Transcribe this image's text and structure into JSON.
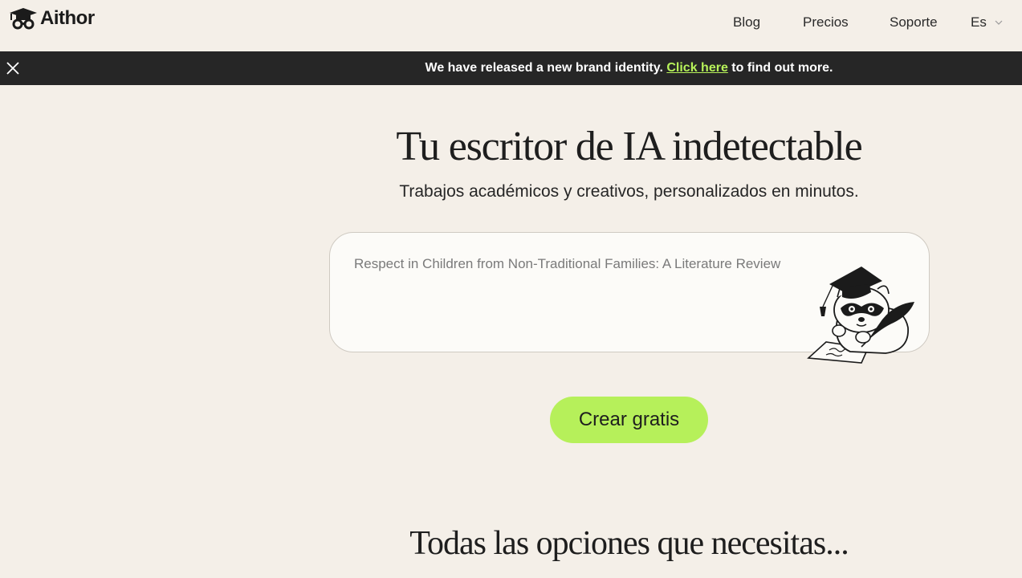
{
  "header": {
    "logo_text": "Aithor",
    "logo_icon": "graduation-cap-mask-icon",
    "nav": {
      "blog": "Blog",
      "precios": "Precios",
      "soporte": "Soporte",
      "language": "Es"
    }
  },
  "announcement": {
    "text_before": "We have released a new brand identity.",
    "link_text": "Click here",
    "text_after": "to find out more.",
    "close_icon": "close-icon",
    "link_color": "#b7f25a"
  },
  "hero": {
    "title": "Tu escritor de IA indetectable",
    "subtitle": "Trabajos académicos y creativos, personalizados en minutos.",
    "prompt_placeholder": "Respect in Children from Non-Traditional Families: A Literature Review",
    "mascot_icon": "raccoon-graduate-icon",
    "cta_label": "Crear gratis",
    "cta_color": "#b6f05a"
  },
  "section": {
    "title": "Todas las opciones que necesitas..."
  }
}
